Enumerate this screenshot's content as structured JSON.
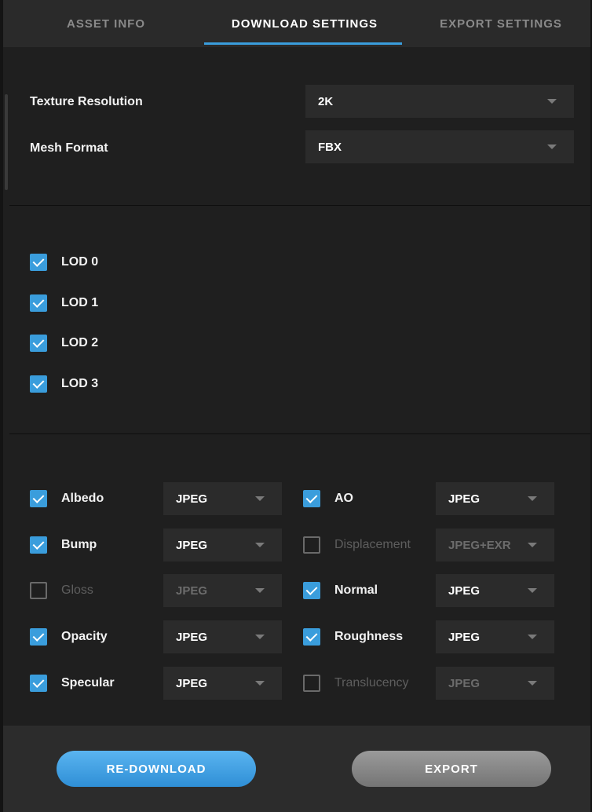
{
  "tabs": [
    {
      "label": "ASSET INFO"
    },
    {
      "label": "DOWNLOAD SETTINGS",
      "active": true
    },
    {
      "label": "EXPORT SETTINGS"
    }
  ],
  "settings": {
    "texture_resolution": {
      "label": "Texture Resolution",
      "value": "2K"
    },
    "mesh_format": {
      "label": "Mesh Format",
      "value": "FBX"
    }
  },
  "lods": [
    {
      "label": "LOD 0",
      "checked": true
    },
    {
      "label": "LOD 1",
      "checked": true
    },
    {
      "label": "LOD 2",
      "checked": true
    },
    {
      "label": "LOD 3",
      "checked": true
    }
  ],
  "maps_left": [
    {
      "label": "Albedo",
      "checked": true,
      "format": "JPEG"
    },
    {
      "label": "Bump",
      "checked": true,
      "format": "JPEG"
    },
    {
      "label": "Gloss",
      "checked": false,
      "format": "JPEG"
    },
    {
      "label": "Opacity",
      "checked": true,
      "format": "JPEG"
    },
    {
      "label": "Specular",
      "checked": true,
      "format": "JPEG"
    }
  ],
  "maps_right": [
    {
      "label": "AO",
      "checked": true,
      "format": "JPEG"
    },
    {
      "label": "Displacement",
      "checked": false,
      "format": "JPEG+EXR"
    },
    {
      "label": "Normal",
      "checked": true,
      "format": "JPEG"
    },
    {
      "label": "Roughness",
      "checked": true,
      "format": "JPEG"
    },
    {
      "label": "Translucency",
      "checked": false,
      "format": "JPEG"
    }
  ],
  "footer": {
    "redownload_label": "RE-DOWNLOAD",
    "export_label": "EXPORT"
  },
  "colors": {
    "accent": "#3a9ddc",
    "background": "#1f1f1f",
    "panel": "#2b2b2b"
  }
}
